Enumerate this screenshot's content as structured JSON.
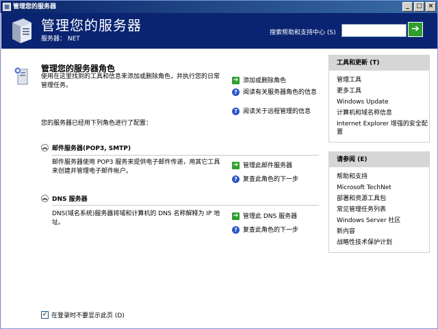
{
  "window": {
    "title": "管理您的服务器",
    "minimize": "_",
    "maximize": "□",
    "close": "×"
  },
  "header": {
    "title": "管理您的服务器",
    "server_line": "服务器： NET",
    "search_label": "搜索帮助和支持中心 (S)",
    "search_value": "",
    "go_glyph": "➔"
  },
  "main": {
    "title": "管理您的服务器角色",
    "description": "使用在这里找到的工具和信息来添加或删除角色，并执行您的日常管理任务。",
    "actions": [
      {
        "icon": "arrow",
        "label": "添加或删除角色"
      },
      {
        "icon": "help",
        "label": "阅读有关服务器角色的信息"
      },
      {
        "icon": "help",
        "label": "阅读关于远程管理的信息"
      }
    ],
    "configured_text": "您的服务器已经用下列角色进行了配置：",
    "roles": [
      {
        "name": "邮件服务器(POP3, SMTP)",
        "description": "邮件服务器使用 POP3 服务来提供电子邮件传递，用其它工具来创建并管理电子邮件帐户。",
        "actions": [
          {
            "icon": "arrow",
            "label": "管理此邮件服务器"
          },
          {
            "icon": "help",
            "label": "复查此角色的下一步"
          }
        ]
      },
      {
        "name": "DNS 服务器",
        "description": "DNS(域名系统)服务器将域和计算机的 DNS 名称解释为 IP 地址。",
        "actions": [
          {
            "icon": "arrow",
            "label": "管理此 DNS 服务器"
          },
          {
            "icon": "help",
            "label": "复查此角色的下一步"
          }
        ]
      }
    ],
    "dont_show": {
      "label": "在登录时不要显示此页 (D)",
      "checked": true
    }
  },
  "sidebar": {
    "tools": {
      "title": "工具和更新 (T)",
      "items": [
        "管理工具",
        "更多工具",
        "Windows Update",
        "计算机和域名称信息",
        "Internet Explorer 增强的安全配置"
      ]
    },
    "see_also": {
      "title": "请参阅 (E)",
      "items": [
        "帮助和支持",
        "Microsoft TechNet",
        "部署和资源工具包",
        "常见管理任务列表",
        "Windows Server 社区",
        "新内容",
        "战略性技术保护计划"
      ]
    }
  },
  "colors": {
    "header_bg": "#0a2472",
    "arrow_green": "#2e9f2e",
    "help_blue": "#2a55c8",
    "panel_header": "#d6d6d6"
  }
}
